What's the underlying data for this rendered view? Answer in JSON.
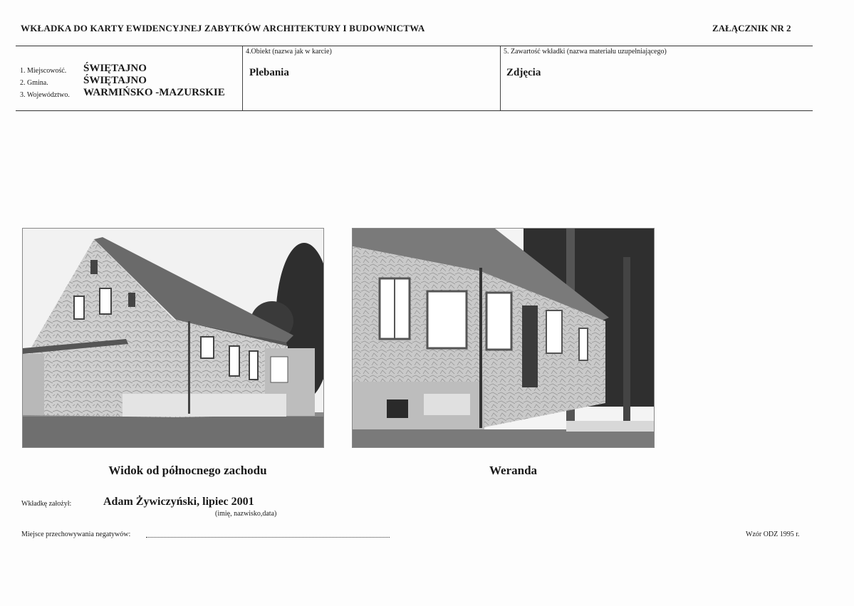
{
  "header": {
    "title": "WKŁADKA DO KARTY EWIDENCYJNEJ ZABYTKÓW ARCHITEKTURY I BUDOWNICTWA",
    "annex": "ZAŁĄCZNIK NR 2"
  },
  "location": {
    "items": [
      {
        "label": "1. Miejscowość.",
        "value": "ŚWIĘTAJNO"
      },
      {
        "label": "2. Gmina.",
        "value": "ŚWIĘTAJNO"
      },
      {
        "label": "3. Województwo.",
        "value": "WARMIŃSKO -MAZURSKIE"
      }
    ]
  },
  "object": {
    "label": "4.Obiekt (nazwa jak w karcie)",
    "value": "Plebania"
  },
  "contents": {
    "label": "5. Zawartość wkładki (nazwa materiału uzupełniającego)",
    "value": "Zdjęcia"
  },
  "photos": [
    {
      "caption": "Widok od północnego zachodu"
    },
    {
      "caption": "Weranda"
    }
  ],
  "author": {
    "label": "Wkładkę założył:",
    "value": "Adam Żywiczyński, lipiec 2001",
    "hint": "(imię, nazwisko,data)"
  },
  "negatives": {
    "label": "Miejsce przechowywania negatywów:"
  },
  "template_note": "Wzór ODZ 1995 r."
}
